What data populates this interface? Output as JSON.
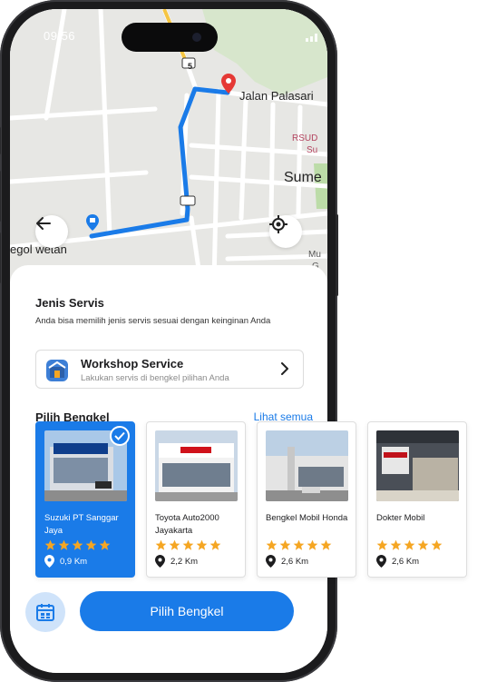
{
  "status_bar": {
    "time": "09.56"
  },
  "map": {
    "labels": {
      "street": "Jalan Palasari",
      "hospital_line1": "RSUD",
      "hospital_line2": "Su",
      "area": "Sume",
      "area2": "egol wetan",
      "edge1": "Mu",
      "edge2": "G",
      "road_number": "5"
    },
    "icons": {
      "back": "arrow-left-icon",
      "locate": "crosshair-icon",
      "destination": "map-pin-icon",
      "origin": "map-marker-icon"
    },
    "colors": {
      "route": "#1a7be8",
      "pin": "#e53935"
    }
  },
  "service": {
    "section_title": "Jenis Servis",
    "description": "Anda bisa memilih jenis servis sesuai dengan keinginan Anda",
    "card": {
      "title": "Workshop Service",
      "subtitle": "Lakukan servis di bengkel pilihan Anda",
      "icon": "workshop-icon"
    }
  },
  "workshops": {
    "section_title": "Pilih Bengkel",
    "see_all": "Lihat semua",
    "items": [
      {
        "name": "Suzuki PT Sanggar Jaya",
        "distance": "0,9 Km",
        "rating": 5,
        "selected": true
      },
      {
        "name": "Toyota Auto2000 Jayakarta",
        "distance": "2,2 Km",
        "rating": 5,
        "selected": false
      },
      {
        "name": "Bengkel Mobil Honda",
        "distance": "2,6 Km",
        "rating": 5,
        "selected": false
      },
      {
        "name": "Dokter Mobil",
        "distance": "2,6 Km",
        "rating": 5,
        "selected": false
      }
    ]
  },
  "actions": {
    "primary_label": "Pilih Bengkel",
    "calendar_icon": "calendar-icon"
  },
  "colors": {
    "primary": "#1a7be8",
    "star": "#f5a623",
    "light_blue": "#cfe3fa"
  }
}
